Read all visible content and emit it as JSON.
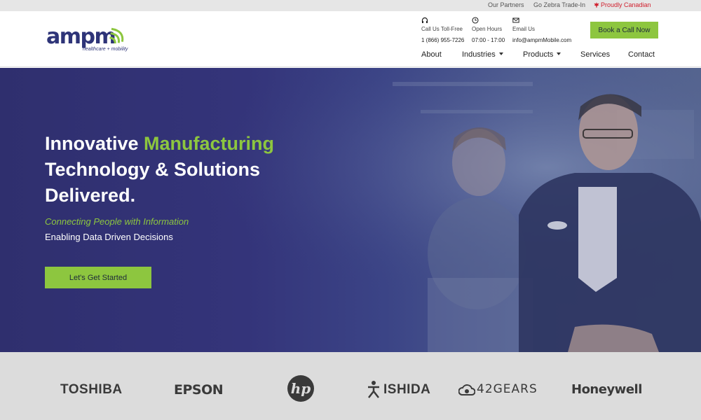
{
  "topbar": {
    "partners": "Our Partners",
    "tradein": "Go Zebra Trade-In",
    "canadian": "Proudly Canadian"
  },
  "logo": {
    "word": "ampm",
    "tagline": "healthcare + mobility"
  },
  "contact": {
    "phone_label": "Call Us Toll-Free",
    "phone_value": "1 (866) 955-7226",
    "hours_label": "Open Hours",
    "hours_value": "07:00 - 17:00",
    "email_label": "Email Us",
    "email_value": "info@ampmMobile.com"
  },
  "book_button": "Book a Call Now",
  "nav": {
    "about": "About",
    "industries": "Industries",
    "products": "Products",
    "services": "Services",
    "contact": "Contact"
  },
  "hero": {
    "title_part1": "Innovative ",
    "title_accent": "Manufacturing",
    "title_line2": "Technology & Solutions",
    "title_line3": "Delivered.",
    "subtitle_green": "Connecting People with Information",
    "subtitle_white": "Enabling Data Driven Decisions",
    "cta": "Let's Get Started"
  },
  "partner_logos": {
    "toshiba": "TOSHIBA",
    "epson": "EPSON",
    "hp": "hp",
    "ishida": "ISHIDA",
    "gears": "42GEARS",
    "honeywell": "Honeywell"
  },
  "icons": [
    "headset-icon",
    "clock-icon",
    "mail-icon",
    "maple-leaf-icon",
    "caret-down-icon"
  ],
  "colors": {
    "brand_navy": "#2e3478",
    "accent_green": "#8dc63f",
    "canada_red": "#d0202e"
  }
}
